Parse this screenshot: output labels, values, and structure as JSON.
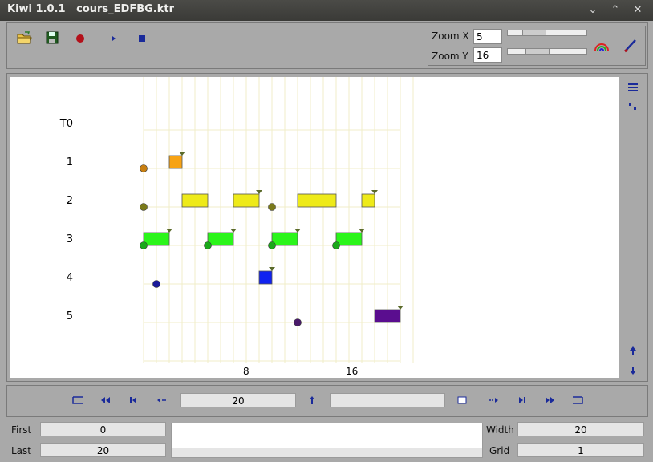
{
  "window": {
    "title": "Kiwi 1.0.1   cours_EDFBG.ktr",
    "minimize": "⌄",
    "maximize": "⌃",
    "close": "✕"
  },
  "toolbar": {
    "icons": [
      "open-folder-icon",
      "save-icon",
      "record-icon",
      "play-icon",
      "stop-icon"
    ],
    "zoom_x_label": "Zoom X",
    "zoom_x_value": "5",
    "zoom_y_label": "Zoom Y",
    "zoom_y_value": "16"
  },
  "rows": [
    "T0",
    "1",
    "2",
    "3",
    "4",
    "5"
  ],
  "timeline": {
    "axis_labels": [
      {
        "value": 8,
        "label": "8"
      },
      {
        "value": 16,
        "label": "16"
      }
    ],
    "range": [
      0,
      20
    ],
    "row_colors": {
      "1": "#f7a315",
      "2": "#eeea19",
      "3": "#2bf51a",
      "4": "#1022f0",
      "5": "#5a0d8f"
    },
    "dot_colors": {
      "1": "#c87f10",
      "2": "#7a7a1a",
      "3": "#1aa81a",
      "4": "#1a1a9a",
      "5": "#4a1a6a"
    },
    "events": [
      {
        "row": 1,
        "dot": 0,
        "block_start": 2,
        "block_end": 3,
        "flag": true
      },
      {
        "row": 2,
        "dot": 0,
        "block_start": 3,
        "block_end": 5,
        "flag": false
      },
      {
        "row": 2,
        "dot": null,
        "block_start": 7,
        "block_end": 9,
        "flag": true
      },
      {
        "row": 2,
        "dot": 10,
        "block_start": 12,
        "block_end": 15,
        "flag": false
      },
      {
        "row": 2,
        "dot": null,
        "block_start": 17,
        "block_end": 18,
        "flag": true
      },
      {
        "row": 3,
        "dot": 0,
        "block_start": 0,
        "block_end": 2,
        "flag": true
      },
      {
        "row": 3,
        "dot": 5,
        "block_start": 5,
        "block_end": 7,
        "flag": true
      },
      {
        "row": 3,
        "dot": 10,
        "block_start": 10,
        "block_end": 12,
        "flag": true
      },
      {
        "row": 3,
        "dot": 15,
        "block_start": 15,
        "block_end": 17,
        "flag": true
      },
      {
        "row": 4,
        "dot": 1,
        "block_start": 9,
        "block_end": 10,
        "flag": true
      },
      {
        "row": 5,
        "dot": 12,
        "block_start": 18,
        "block_end": 20,
        "flag": true
      }
    ]
  },
  "navigation": {
    "position": "20",
    "secondary": ""
  },
  "status": {
    "first_label": "First",
    "first_value": "0",
    "last_label": "Last",
    "last_value": "20",
    "width_label": "Width",
    "width_value": "20",
    "grid_label": "Grid",
    "grid_value": "1"
  }
}
